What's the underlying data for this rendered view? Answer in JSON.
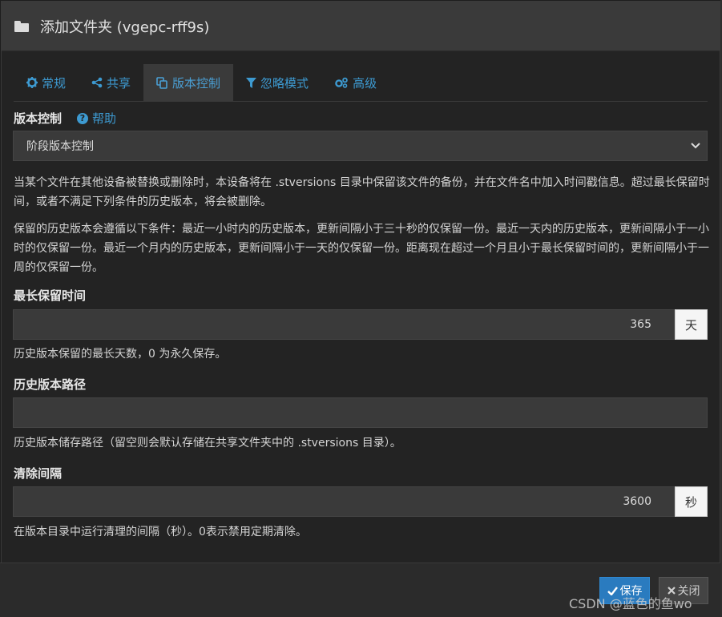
{
  "dialog": {
    "title": "添加文件夹 (vgepc-rff9s)"
  },
  "tabs": [
    {
      "label": "常规",
      "icon": "gear-icon",
      "active": false
    },
    {
      "label": "共享",
      "icon": "share-icon",
      "active": false
    },
    {
      "label": "版本控制",
      "icon": "copy-icon",
      "active": true
    },
    {
      "label": "忽略模式",
      "icon": "filter-icon",
      "active": false
    },
    {
      "label": "高级",
      "icon": "gears-icon",
      "active": false
    }
  ],
  "versioning": {
    "label": "版本控制",
    "help": "帮助",
    "selected": "阶段版本控制",
    "desc1": "当某个文件在其他设备被替换或删除时，本设备将在 .stversions 目录中保留该文件的备份，并在文件名中加入时间戳信息。超过最长保留时间，或者不满足下列条件的历史版本，将会被删除。",
    "desc2": "保留的历史版本会遵循以下条件：最近一小时内的历史版本，更新间隔小于三十秒的仅保留一份。最近一天内的历史版本，更新间隔小于一小时的仅保留一份。最近一个月内的历史版本，更新间隔小于一天的仅保留一份。距离现在超过一个月且小于最长保留时间的，更新间隔小于一周的仅保留一份。"
  },
  "max_age": {
    "label": "最长保留时间",
    "value": "365",
    "unit": "天",
    "help": "历史版本保留的最长天数，0 为永久保存。"
  },
  "versions_path": {
    "label": "历史版本路径",
    "value": "",
    "help": "历史版本储存路径（留空则会默认存储在共享文件夹中的 .stversions 目录）。"
  },
  "cleanup": {
    "label": "清除间隔",
    "value": "3600",
    "unit": "秒",
    "help": "在版本目录中运行清理的间隔（秒）。0表示禁用定期清除。"
  },
  "footer": {
    "save": "保存",
    "close": "关闭"
  },
  "watermark": "CSDN @蓝色的鱼wo",
  "colors": {
    "accent": "#3d9ad1",
    "header_bg": "#3a3a3a",
    "save_bg": "#2a7bbf"
  }
}
